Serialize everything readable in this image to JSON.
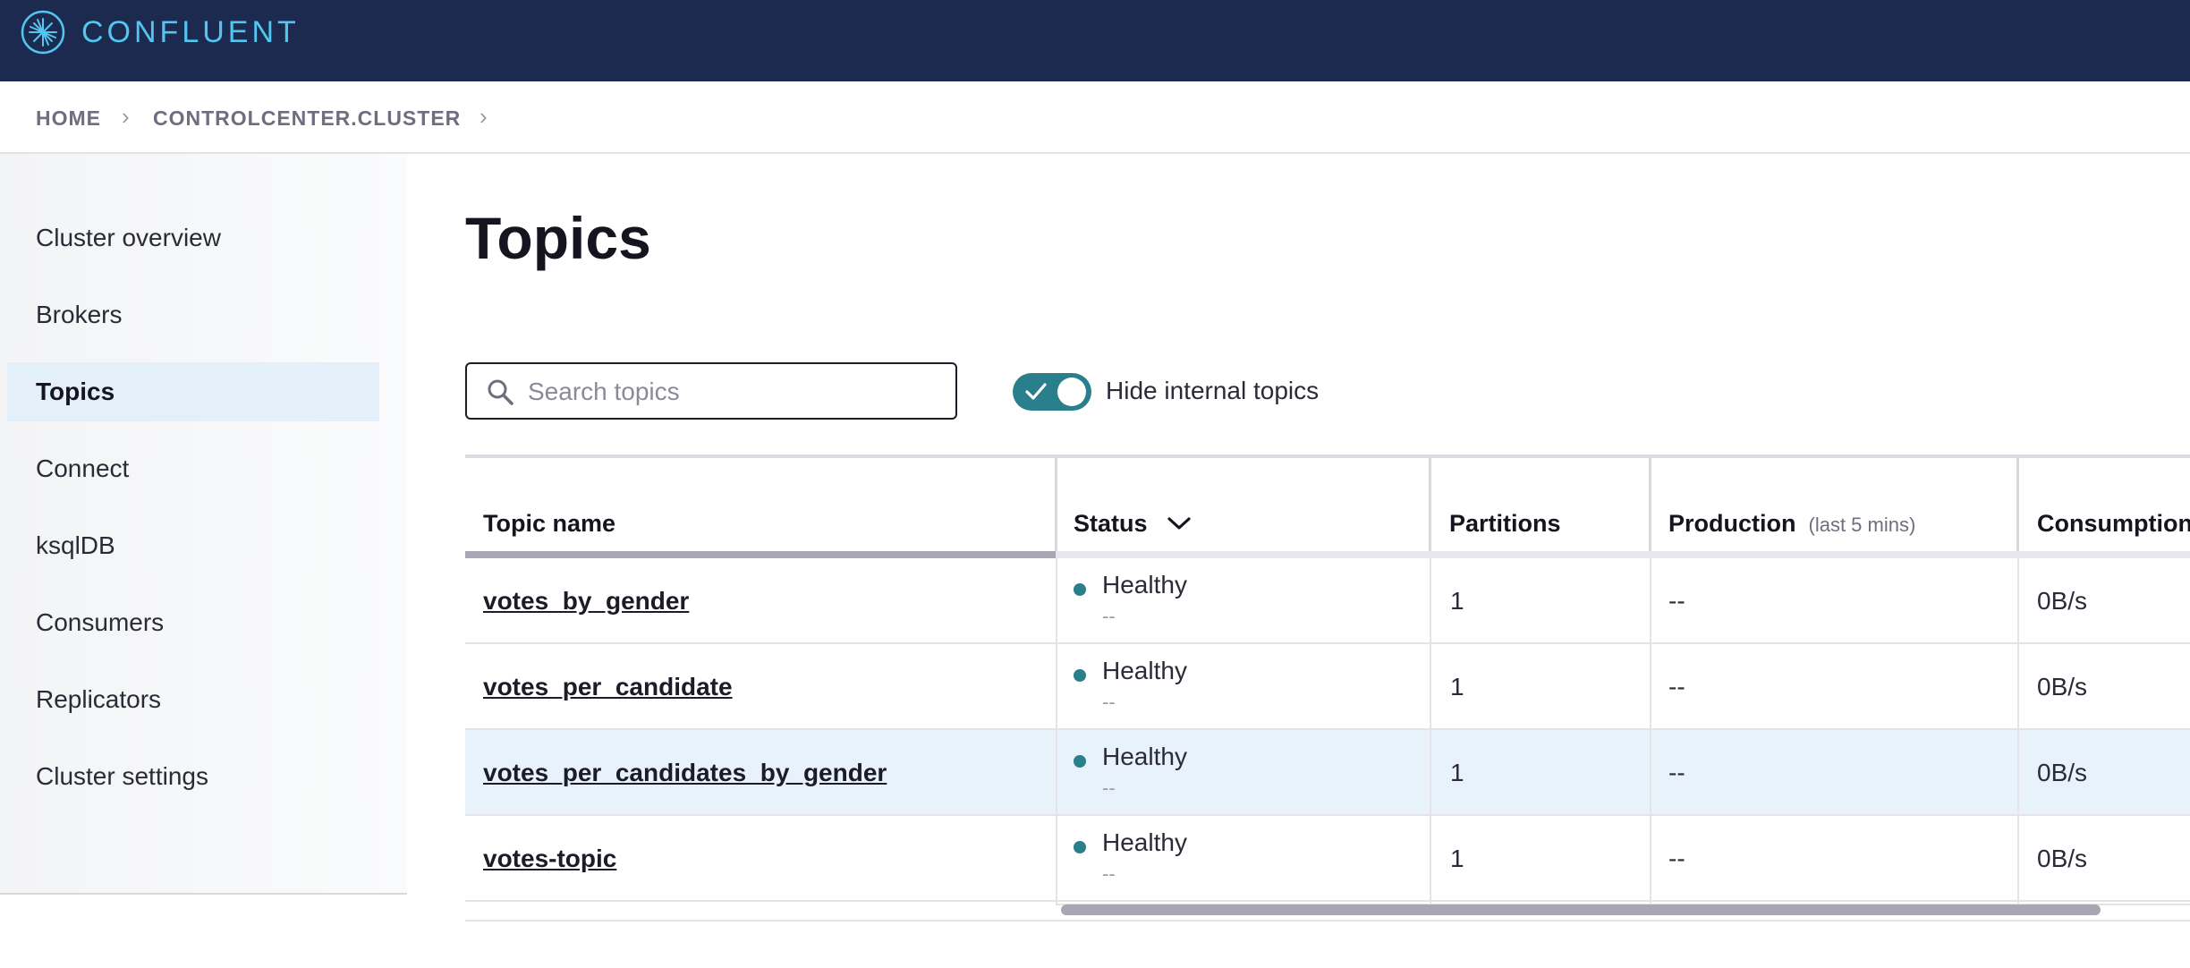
{
  "header": {
    "brand": "CONFLUENT"
  },
  "breadcrumb": {
    "home": "HOME",
    "cluster": "CONTROLCENTER.CLUSTER"
  },
  "sidebar": {
    "items": [
      {
        "label": "Cluster overview"
      },
      {
        "label": "Brokers"
      },
      {
        "label": "Topics",
        "active": true
      },
      {
        "label": "Connect"
      },
      {
        "label": "ksqlDB"
      },
      {
        "label": "Consumers"
      },
      {
        "label": "Replicators"
      },
      {
        "label": "Cluster settings"
      }
    ]
  },
  "main": {
    "title": "Topics",
    "search": {
      "placeholder": "Search topics",
      "value": ""
    },
    "toggle": {
      "label": "Hide internal topics",
      "checked": true
    }
  },
  "table": {
    "columns": {
      "topic": "Topic name",
      "status": "Status",
      "partitions": "Partitions",
      "production": "Production",
      "production_sub": "(last 5 mins)",
      "consumption": "Consumption"
    },
    "rows": [
      {
        "topic": "votes_by_gender",
        "status": "Healthy",
        "status_sub": "--",
        "partitions": "1",
        "production": "--",
        "consumption": "0B/s"
      },
      {
        "topic": "votes_per_candidate",
        "status": "Healthy",
        "status_sub": "--",
        "partitions": "1",
        "production": "--",
        "consumption": "0B/s"
      },
      {
        "topic": "votes_per_candidates_by_gender",
        "status": "Healthy",
        "status_sub": "--",
        "partitions": "1",
        "production": "--",
        "consumption": "0B/s"
      },
      {
        "topic": "votes-topic",
        "status": "Healthy",
        "status_sub": "--",
        "partitions": "1",
        "production": "--",
        "consumption": "0B/s"
      }
    ]
  },
  "colors": {
    "header_bg": "#1b2a4e",
    "brand": "#52c6f0",
    "accent": "#2a7f8c",
    "active_nav": "#e4f0f9"
  }
}
